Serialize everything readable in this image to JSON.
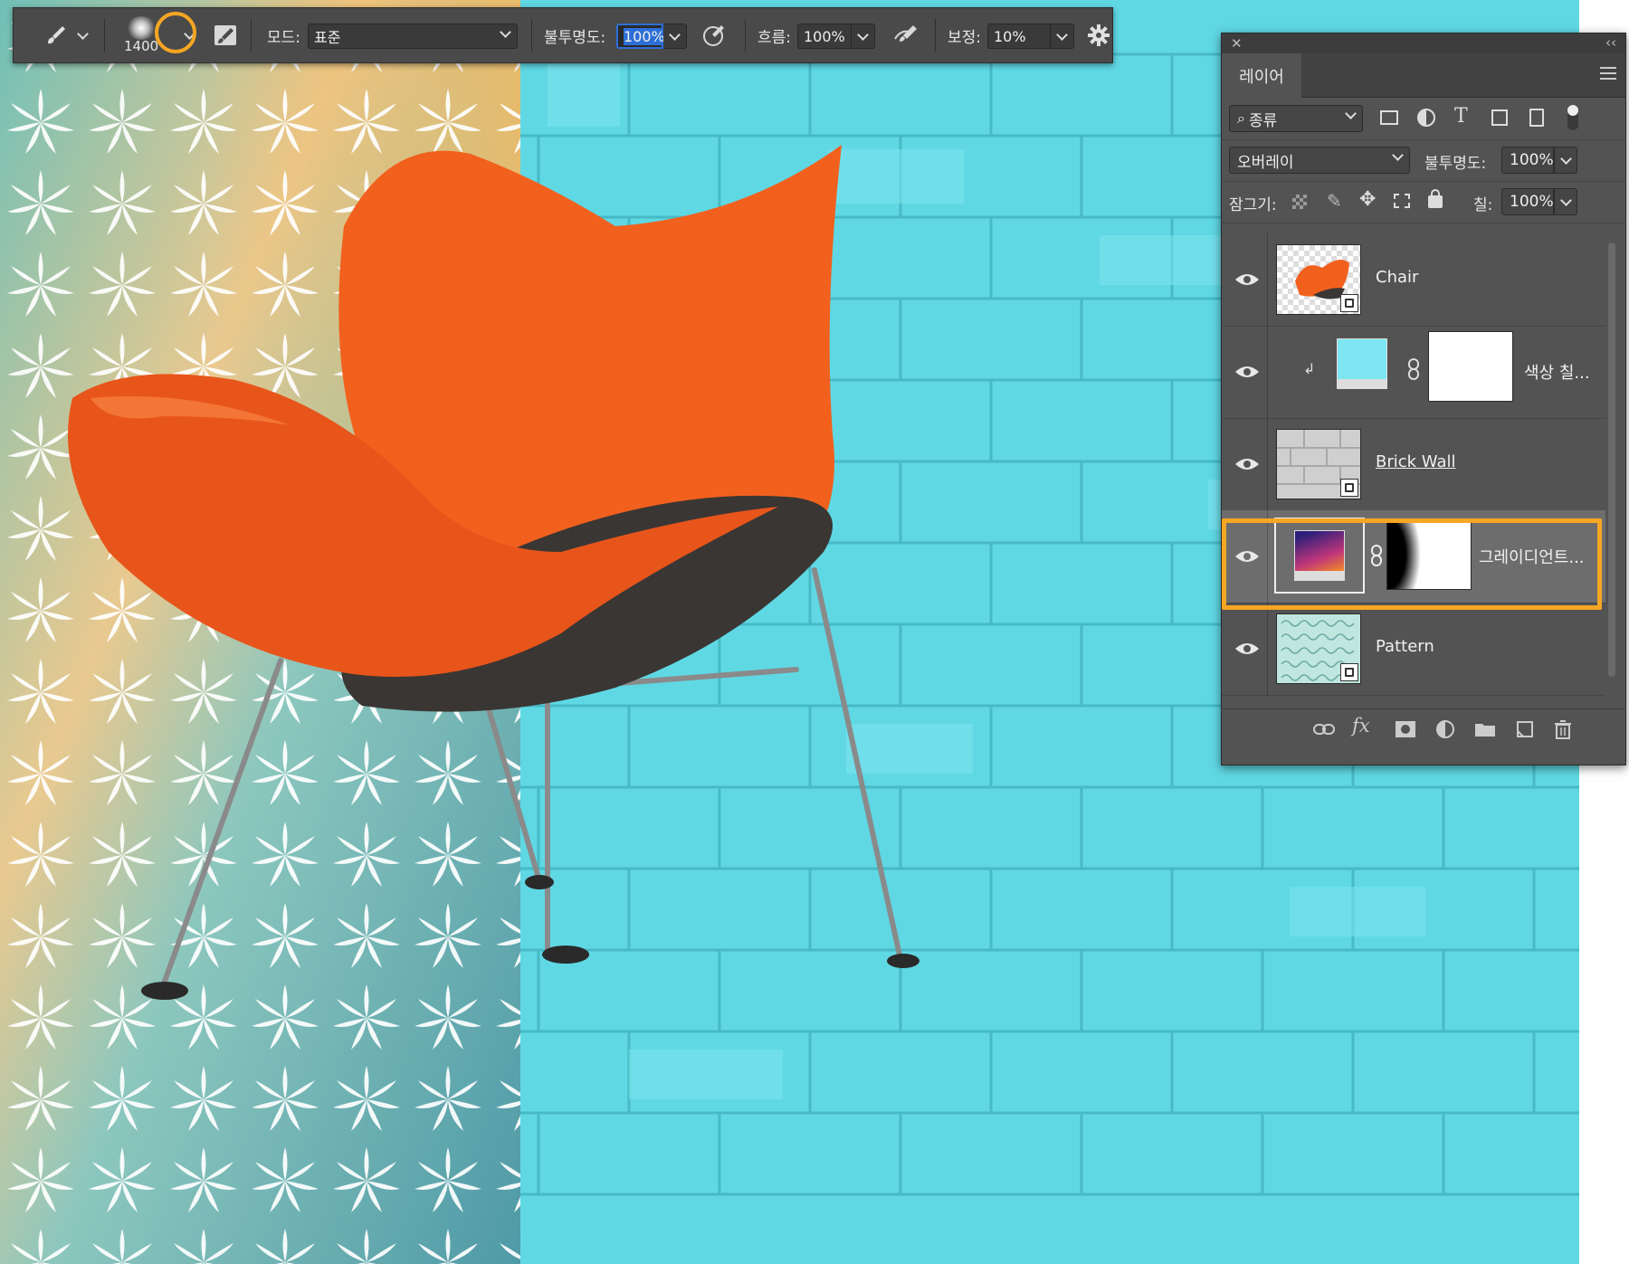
{
  "options_bar": {
    "brush_size": "1400",
    "mode_label": "모드:",
    "mode_value": "표준",
    "opacity_label": "불투명도:",
    "opacity_value": "100%",
    "flow_label": "흐름:",
    "flow_value": "100%",
    "smoothing_label": "보정:",
    "smoothing_value": "10%"
  },
  "layers_panel": {
    "tab_label": "레이어",
    "filter_value": "종류",
    "blend_mode": "오버레이",
    "opacity_label": "불투명도:",
    "opacity_value": "100%",
    "lock_label": "잠그기:",
    "fill_label": "칠:",
    "fill_value": "100%",
    "layers": [
      {
        "name": "Chair",
        "selected": false
      },
      {
        "name": "색상 칠...",
        "selected": false
      },
      {
        "name": "Brick Wall",
        "selected": false
      },
      {
        "name": "그레이디언트...",
        "selected": true
      },
      {
        "name": "Pattern",
        "selected": false
      }
    ]
  },
  "icons": {
    "brush": "brush-icon",
    "airbrush": "airbrush-icon",
    "pressure": "pressure-icon",
    "settings": "gear-icon",
    "visibility": "eye-icon",
    "link": "link-icon",
    "fx": "fx-icon",
    "mask": "mask-icon",
    "adjustment": "adjustment-icon",
    "folder": "folder-icon",
    "new_layer": "new-layer-icon",
    "delete": "trash-icon"
  },
  "colors": {
    "accent_highlight": "#f5a623",
    "wall_cyan": "#5fd8e4",
    "chair_orange": "#f2601e",
    "panel_bg": "#535353"
  }
}
